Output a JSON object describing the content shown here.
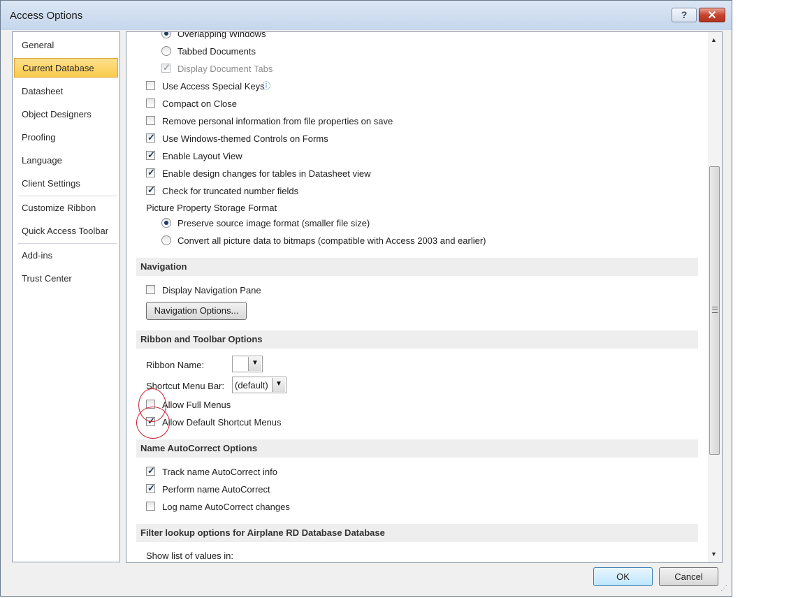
{
  "window": {
    "title": "Access Options",
    "help_label": "?",
    "close_label": "✕"
  },
  "nav": {
    "items": [
      {
        "label": "General"
      },
      {
        "label": "Current Database"
      },
      {
        "label": "Datasheet"
      },
      {
        "label": "Object Designers"
      },
      {
        "label": "Proofing"
      },
      {
        "label": "Language"
      },
      {
        "label": "Client Settings"
      },
      {
        "label": "Customize Ribbon"
      },
      {
        "label": "Quick Access Toolbar"
      },
      {
        "label": "Add-ins"
      },
      {
        "label": "Trust Center"
      }
    ],
    "selected": "Current Database"
  },
  "doc_window": {
    "overlapping_label": "Overlapping Windows",
    "tabbed_label": "Tabbed Documents",
    "display_tabs_label": "Display Document Tabs"
  },
  "app_options": {
    "special_keys_label": "Use Access Special Keys",
    "compact_label": "Compact on Close",
    "remove_info_label": "Remove personal information from file properties on save",
    "windows_themed_label": "Use Windows-themed Controls on Forms",
    "layout_view_label": "Enable Layout View",
    "design_changes_label": "Enable design changes for tables in Datasheet view",
    "truncated_label": "Check for truncated number fields",
    "picture_storage_label": "Picture Property Storage Format",
    "preserve_label": "Preserve source image format (smaller file size)",
    "convert_label": "Convert all picture data to bitmaps (compatible with Access 2003 and earlier)"
  },
  "navigation": {
    "section_title": "Navigation",
    "display_pane_label": "Display Navigation Pane",
    "options_button": "Navigation Options..."
  },
  "ribbon": {
    "section_title": "Ribbon and Toolbar Options",
    "ribbon_name_label": "Ribbon Name:",
    "ribbon_name_value": "",
    "shortcut_bar_label": "Shortcut Menu Bar:",
    "shortcut_bar_value": "(default)",
    "full_menus_label": "Allow Full Menus",
    "default_shortcut_label": "Allow Default Shortcut Menus"
  },
  "autocorrect": {
    "section_title": "Name AutoCorrect Options",
    "track_label": "Track name AutoCorrect info",
    "perform_label": "Perform name AutoCorrect",
    "log_label": "Log name AutoCorrect changes"
  },
  "filter": {
    "section_title": "Filter lookup options for Airplane RD Database Database",
    "show_list_label": "Show list of values in:"
  },
  "footer": {
    "ok_label": "OK",
    "cancel_label": "Cancel"
  },
  "glyphs": {
    "check": "✓",
    "dropdown": "▼",
    "scroll_up": "▲",
    "scroll_down": "▼",
    "info": "ⓘ",
    "resize": "⋰"
  },
  "colors": {
    "annotation": "#cf1f2e",
    "nav_selected": "#fbcb4e"
  }
}
